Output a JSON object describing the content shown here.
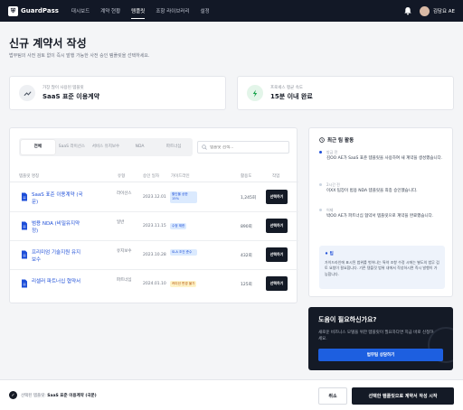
{
  "nav": {
    "brand": "GuardPass",
    "items": [
      {
        "label": "대시보드"
      },
      {
        "label": "계약 현황"
      },
      {
        "label": "템플릿"
      },
      {
        "label": "조항 라이브러리"
      },
      {
        "label": "설정"
      }
    ],
    "active_index": 2,
    "user_name": "김담요 AE"
  },
  "header": {
    "title": "신규 계약서 작성",
    "subtitle": "법무팀의 사전 검토 없이 즉시 발행 가능한 사전 승인 템플릿을 선택하세요."
  },
  "stats": [
    {
      "label": "가장 많이 사용된 템플릿",
      "value": "SaaS 표준 이용계약",
      "icon": "trending-up-icon",
      "icon_color": "#4b5563",
      "bg": "#eef0f3"
    },
    {
      "label": "프로세스 평균 속도",
      "value": "15분 이내 완료",
      "icon": "lightning-icon",
      "icon_color": "#16a34a",
      "bg": "#e3f5e9"
    }
  ],
  "templates": {
    "tabs": [
      "전체",
      "SaaS 라이선스",
      "서비스 유지보수",
      "NDA",
      "파트너십"
    ],
    "active_tab": 0,
    "search_placeholder": "템플릿 검색...",
    "columns": [
      "템플릿 명칭",
      "유형",
      "승인 일자",
      "가이드라인",
      "활용도",
      "작업"
    ],
    "rows": [
      {
        "name": "SaaS 표준 이용계약 (국문)",
        "type": "라이선스",
        "date": "2023.12.01",
        "guide": "할인율 상한 15%",
        "guide_bg": "#dbeafe",
        "guide_color": "#1d4ed8",
        "usage": "1,245회",
        "action": "선택하기"
      },
      {
        "name": "범용 NDA (비밀유지약정)",
        "type": "일반",
        "date": "2023.11.15",
        "guide": "수정 제한",
        "guide_bg": "#dbeafe",
        "guide_color": "#1d4ed8",
        "usage": "890회",
        "action": "선택하기"
      },
      {
        "name": "프리미엄 기술지원 유지보수",
        "type": "유지보수",
        "date": "2023.10.28",
        "guide": "SLA 조건 준수",
        "guide_bg": "#dbeafe",
        "guide_color": "#1d4ed8",
        "usage": "432회",
        "action": "선택하기"
      },
      {
        "name": "리셀러 파트너십 협약서",
        "type": "파트너십",
        "date": "2024.01.10",
        "guide": "커미션 변경 불가",
        "guide_bg": "#fef3c7",
        "guide_color": "#b45309",
        "usage": "125회",
        "action": "선택하기"
      }
    ]
  },
  "activity": {
    "title": "최근 팀 활동",
    "items": [
      {
        "time": "방금 전",
        "text": "김OO AE가 SaaS 표준 템플릿을 사용하여 새 계약을 생성했습니다."
      },
      {
        "time": "2시간 전",
        "text": "이XX 팀장이 범용 NDA 템플릿을 최종 승인했습니다."
      },
      {
        "time": "어제",
        "text": "박OO AE가 파트너십 협약서 템플릿으로 계약을 완료했습니다."
      }
    ],
    "tip_title": "♦ 팁",
    "tip_text": "가이드라인에 표시된 범위를 벗어나는 특약 조항 수정 시에는 별도의 법무 검토 요청이 필요합니다. 기존 템플릿 범위 내에서 작성하시면 즉시 발행이 가능합니다."
  },
  "help": {
    "title": "도움이 필요하신가요?",
    "text": "새로운 비즈니스 모델을 위한 템플릿이 필요하다면 지금 바로 신청하세요.",
    "button": "법무팀 상담하기"
  },
  "footer": {
    "selected_prefix": "선택된 템플릿:",
    "selected_value": "SaaS 표준 이용계약 (국문)",
    "cancel": "취소",
    "create": "선택한 템플릿으로 계약서 작성 시작"
  },
  "colors": {
    "nav_bg": "#121826",
    "primary": "#1d5fe0",
    "dark_button": "#141a26"
  }
}
